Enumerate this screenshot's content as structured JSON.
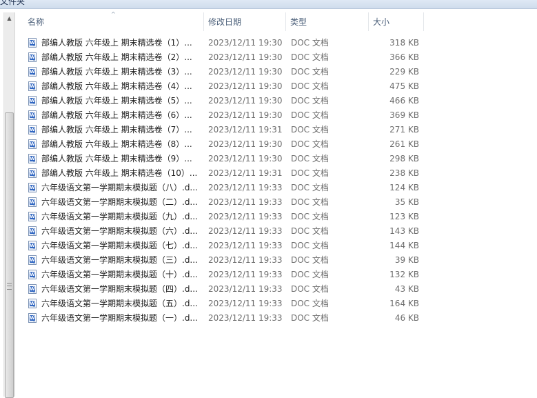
{
  "window": {
    "title_fragment": "文件夹"
  },
  "columns": [
    {
      "label": "名称"
    },
    {
      "label": "修改日期"
    },
    {
      "label": "类型"
    },
    {
      "label": "大小"
    }
  ],
  "files": [
    {
      "name": "部编人教版 六年级上 期末精选卷（1）...",
      "date": "2023/12/11 19:30",
      "type": "DOC 文档",
      "size": "318 KB"
    },
    {
      "name": "部编人教版 六年级上 期末精选卷（2）...",
      "date": "2023/12/11 19:30",
      "type": "DOC 文档",
      "size": "366 KB"
    },
    {
      "name": "部编人教版 六年级上 期末精选卷（3）...",
      "date": "2023/12/11 19:30",
      "type": "DOC 文档",
      "size": "229 KB"
    },
    {
      "name": "部编人教版 六年级上 期末精选卷（4）...",
      "date": "2023/12/11 19:30",
      "type": "DOC 文档",
      "size": "475 KB"
    },
    {
      "name": "部编人教版 六年级上 期末精选卷（5）...",
      "date": "2023/12/11 19:30",
      "type": "DOC 文档",
      "size": "466 KB"
    },
    {
      "name": "部编人教版 六年级上 期末精选卷（6）...",
      "date": "2023/12/11 19:30",
      "type": "DOC 文档",
      "size": "369 KB"
    },
    {
      "name": "部编人教版 六年级上 期末精选卷（7）...",
      "date": "2023/12/11 19:31",
      "type": "DOC 文档",
      "size": "271 KB"
    },
    {
      "name": "部编人教版 六年级上 期末精选卷（8）...",
      "date": "2023/12/11 19:30",
      "type": "DOC 文档",
      "size": "261 KB"
    },
    {
      "name": "部编人教版 六年级上 期末精选卷（9）...",
      "date": "2023/12/11 19:30",
      "type": "DOC 文档",
      "size": "298 KB"
    },
    {
      "name": "部编人教版 六年级上 期末精选卷（10）...",
      "date": "2023/12/11 19:31",
      "type": "DOC 文档",
      "size": "238 KB"
    },
    {
      "name": "六年级语文第一学期期末模拟题（八）.d...",
      "date": "2023/12/11 19:33",
      "type": "DOC 文档",
      "size": "124 KB"
    },
    {
      "name": "六年级语文第一学期期末模拟题（二）.d...",
      "date": "2023/12/11 19:33",
      "type": "DOC 文档",
      "size": "35 KB"
    },
    {
      "name": "六年级语文第一学期期末模拟题（九）.d...",
      "date": "2023/12/11 19:33",
      "type": "DOC 文档",
      "size": "123 KB"
    },
    {
      "name": "六年级语文第一学期期末模拟题（六）.d...",
      "date": "2023/12/11 19:33",
      "type": "DOC 文档",
      "size": "143 KB"
    },
    {
      "name": "六年级语文第一学期期末模拟题（七）.d...",
      "date": "2023/12/11 19:33",
      "type": "DOC 文档",
      "size": "144 KB"
    },
    {
      "name": "六年级语文第一学期期末模拟题（三）.d...",
      "date": "2023/12/11 19:33",
      "type": "DOC 文档",
      "size": "39 KB"
    },
    {
      "name": "六年级语文第一学期期末模拟题（十）.d...",
      "date": "2023/12/11 19:33",
      "type": "DOC 文档",
      "size": "132 KB"
    },
    {
      "name": "六年级语文第一学期期末模拟题（四）.d...",
      "date": "2023/12/11 19:33",
      "type": "DOC 文档",
      "size": "43 KB"
    },
    {
      "name": "六年级语文第一学期期末模拟题（五）.d...",
      "date": "2023/12/11 19:33",
      "type": "DOC 文档",
      "size": "164 KB"
    },
    {
      "name": "六年级语文第一学期期末模拟题（一）.d...",
      "date": "2023/12/11 19:33",
      "type": "DOC 文档",
      "size": "46 KB"
    }
  ],
  "icons": {
    "file": "word-doc-icon",
    "scroll_up": "arrow-up-icon",
    "sort": "sort-ascending-icon"
  }
}
